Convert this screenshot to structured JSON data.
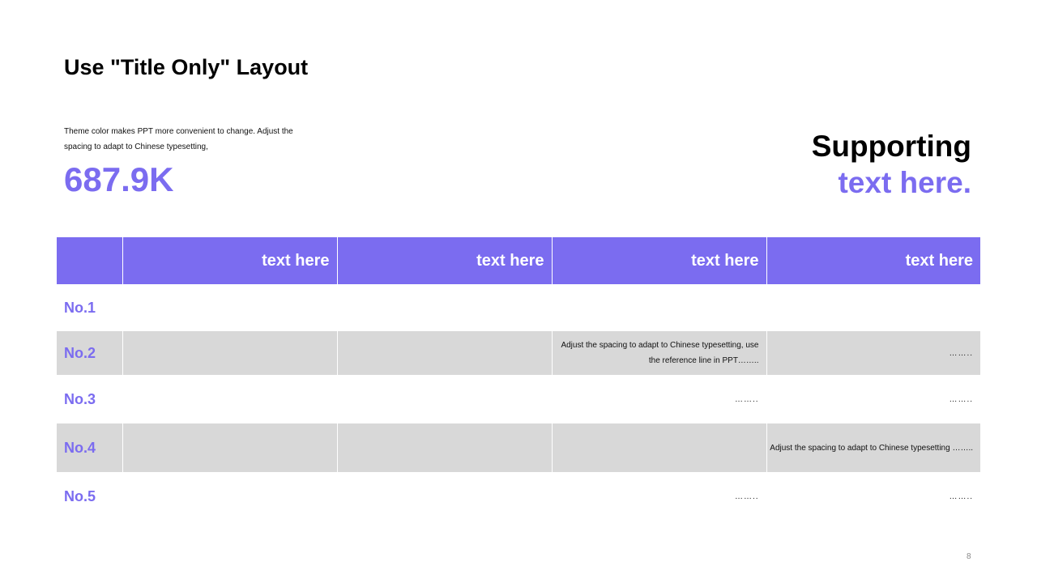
{
  "title": "Use \"Title Only\" Layout",
  "description": "Theme color makes PPT more convenient  to change. Adjust the spacing to adapt to Chinese typesetting,",
  "big_number": "687.9K",
  "supporting": {
    "line1": "Supporting",
    "line2": "text here."
  },
  "table": {
    "headers": [
      "",
      "text here",
      "text here",
      "text here",
      "text here"
    ],
    "rows": [
      {
        "label": "No.1",
        "cells": [
          "",
          "",
          "",
          ""
        ]
      },
      {
        "label": "No.2",
        "cells": [
          "",
          "",
          "Adjust the spacing to adapt to Chinese typesetting, use the reference line in PPT……..",
          "…….."
        ]
      },
      {
        "label": "No.3",
        "cells": [
          "",
          "",
          "……..",
          "…….."
        ]
      },
      {
        "label": "No.4",
        "cells": [
          "",
          "",
          "",
          "Adjust the spacing to adapt to Chinese typesetting …….."
        ]
      },
      {
        "label": "No.5",
        "cells": [
          "",
          "",
          "……..",
          "…….."
        ]
      }
    ]
  },
  "page_number": "8",
  "colors": {
    "accent": "#7b6cf0",
    "shaded_row": "#d8d8d8",
    "text": "#000000"
  }
}
